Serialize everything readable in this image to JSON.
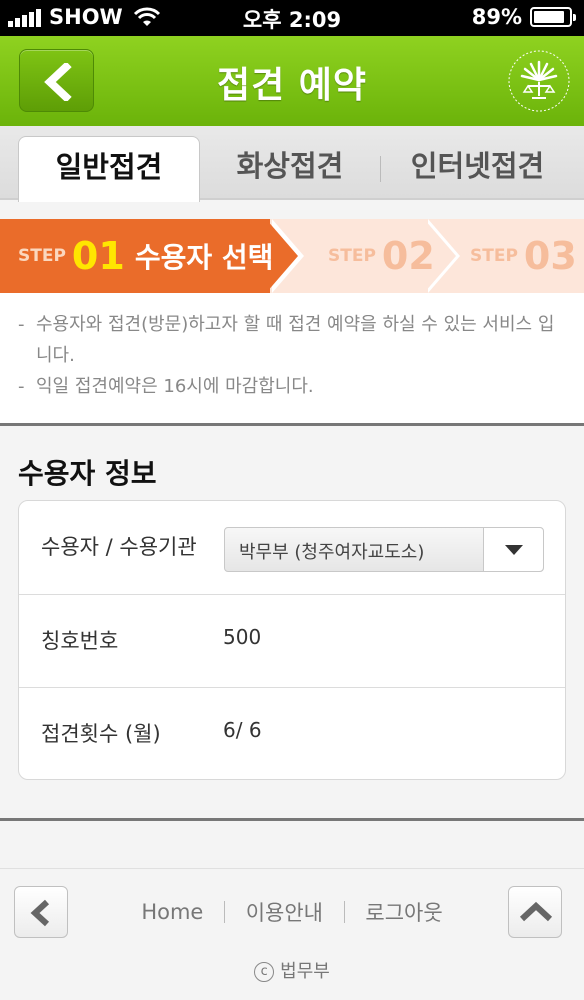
{
  "status_bar": {
    "carrier": "SHOW",
    "time": "오후 2:09",
    "battery_percent": 89,
    "battery_text": "89%",
    "icons": [
      "signal-icon",
      "wifi-icon",
      "battery-icon"
    ]
  },
  "header": {
    "title": "접견 예약",
    "back_icon": "chevron-left-icon",
    "logo": "ministry-of-justice-logo"
  },
  "tabs": [
    {
      "label": "일반접견",
      "active": true
    },
    {
      "label": "화상접견",
      "active": false
    },
    {
      "label": "인터넷접견",
      "active": false
    }
  ],
  "steps": [
    {
      "prefix": "STEP",
      "number": "01",
      "label": "수용자 선택",
      "active": true
    },
    {
      "prefix": "STEP",
      "number": "02",
      "label": "",
      "active": false
    },
    {
      "prefix": "STEP",
      "number": "03",
      "label": "",
      "active": false
    }
  ],
  "notice": {
    "lines": [
      "수용자와 접견(방문)하고자 할 때 접견 예약을 하실 수 있는 서비스 입니다.",
      "익일 접견예약은 16시에 마감합니다."
    ]
  },
  "section": {
    "title": "수용자 정보",
    "rows": [
      {
        "label": "수용자 / 수용기관",
        "value": "박무부 (청주여자교도소)"
      },
      {
        "label": "칭호번호",
        "value": "500"
      },
      {
        "label": "접견횟수 (월)",
        "value": "6/ 6"
      }
    ]
  },
  "footer": {
    "nav": [
      "Home",
      "이용안내",
      "로그아웃"
    ],
    "copyright_symbol": "c",
    "copyright": "법무부"
  },
  "colors": {
    "header_green": "#7cc414",
    "step_orange": "#ea6c2a",
    "step_number_yellow": "#ffe600"
  }
}
